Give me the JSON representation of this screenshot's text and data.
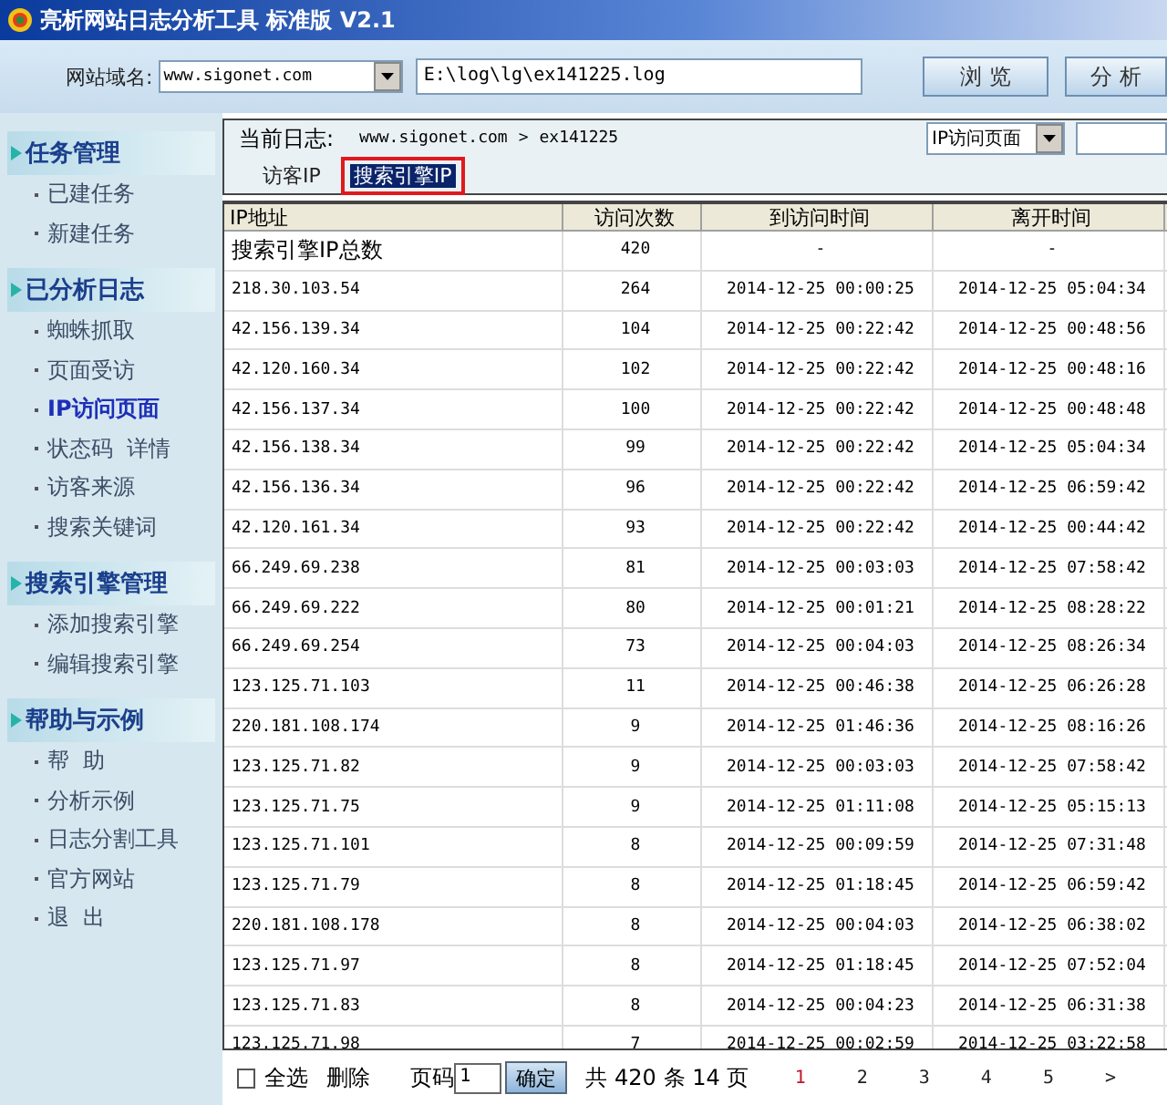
{
  "window": {
    "title": "亮析网站日志分析工具 标准版 V2.1"
  },
  "toolbar": {
    "domain_label": "网站域名:",
    "domain_value": "www.sigonet.com",
    "path_value": "E:\\log\\lg\\ex141225.log",
    "buttons": [
      "浏 览",
      "分 析"
    ]
  },
  "sidebar": {
    "groups": [
      {
        "title": "任务管理",
        "items": [
          {
            "label": "已建任务",
            "selected": false
          },
          {
            "label": "新建任务",
            "selected": false
          }
        ]
      },
      {
        "title": "已分析日志",
        "items": [
          {
            "label": "蜘蛛抓取",
            "selected": false
          },
          {
            "label": "页面受访",
            "selected": false
          },
          {
            "label": "IP访问页面",
            "selected": true
          },
          {
            "label": "状态码  详情",
            "selected": false
          },
          {
            "label": "访客来源",
            "selected": false
          },
          {
            "label": "搜索关键词",
            "selected": false
          }
        ]
      },
      {
        "title": "搜索引擎管理",
        "items": [
          {
            "label": "添加搜索引擎",
            "selected": false
          },
          {
            "label": "编辑搜索引擎",
            "selected": false
          }
        ]
      },
      {
        "title": "帮助与示例",
        "items": [
          {
            "label": "帮  助",
            "selected": false
          },
          {
            "label": "分析示例",
            "selected": false
          },
          {
            "label": "日志分割工具",
            "selected": false
          },
          {
            "label": "官方网站",
            "selected": false
          },
          {
            "label": "退  出",
            "selected": false
          }
        ]
      }
    ]
  },
  "breadcrumb": {
    "label": "当前日志:",
    "site": "www.sigonet.com",
    "separator": ">",
    "log": "ex141225"
  },
  "view_select": {
    "value": "IP访问页面"
  },
  "tabs": [
    {
      "label": "访客IP",
      "selected": false
    },
    {
      "label": "搜索引擎IP",
      "selected": true
    }
  ],
  "table": {
    "columns": [
      "IP地址",
      "访问次数",
      "到访问时间",
      "离开时间"
    ],
    "rows": [
      [
        "搜索引擎IP总数",
        "420",
        "-",
        "-"
      ],
      [
        "218.30.103.54",
        "264",
        "2014-12-25 00:00:25",
        "2014-12-25 05:04:34"
      ],
      [
        "42.156.139.34",
        "104",
        "2014-12-25 00:22:42",
        "2014-12-25 00:48:56"
      ],
      [
        "42.120.160.34",
        "102",
        "2014-12-25 00:22:42",
        "2014-12-25 00:48:16"
      ],
      [
        "42.156.137.34",
        "100",
        "2014-12-25 00:22:42",
        "2014-12-25 00:48:48"
      ],
      [
        "42.156.138.34",
        "99",
        "2014-12-25 00:22:42",
        "2014-12-25 05:04:34"
      ],
      [
        "42.156.136.34",
        "96",
        "2014-12-25 00:22:42",
        "2014-12-25 06:59:42"
      ],
      [
        "42.120.161.34",
        "93",
        "2014-12-25 00:22:42",
        "2014-12-25 00:44:42"
      ],
      [
        "66.249.69.238",
        "81",
        "2014-12-25 00:03:03",
        "2014-12-25 07:58:42"
      ],
      [
        "66.249.69.222",
        "80",
        "2014-12-25 00:01:21",
        "2014-12-25 08:28:22"
      ],
      [
        "66.249.69.254",
        "73",
        "2014-12-25 00:04:03",
        "2014-12-25 08:26:34"
      ],
      [
        "123.125.71.103",
        "11",
        "2014-12-25 00:46:38",
        "2014-12-25 06:26:28"
      ],
      [
        "220.181.108.174",
        "9",
        "2014-12-25 01:46:36",
        "2014-12-25 08:16:26"
      ],
      [
        "123.125.71.82",
        "9",
        "2014-12-25 00:03:03",
        "2014-12-25 07:58:42"
      ],
      [
        "123.125.71.75",
        "9",
        "2014-12-25 01:11:08",
        "2014-12-25 05:15:13"
      ],
      [
        "123.125.71.101",
        "8",
        "2014-12-25 00:09:59",
        "2014-12-25 07:31:48"
      ],
      [
        "123.125.71.79",
        "8",
        "2014-12-25 01:18:45",
        "2014-12-25 06:59:42"
      ],
      [
        "220.181.108.178",
        "8",
        "2014-12-25 00:04:03",
        "2014-12-25 06:38:02"
      ],
      [
        "123.125.71.97",
        "8",
        "2014-12-25 01:18:45",
        "2014-12-25 07:52:04"
      ],
      [
        "123.125.71.83",
        "8",
        "2014-12-25 00:04:23",
        "2014-12-25 06:31:38"
      ],
      [
        "123.125.71.98",
        "7",
        "2014-12-25 00:02:59",
        "2014-12-25 03:22:58"
      ]
    ]
  },
  "footer": {
    "select_all": {
      "label": "全选",
      "checked": false
    },
    "delete": "删除",
    "page_label": "页码",
    "page_value": "1",
    "confirm": "确定",
    "summary": "共 420 条 14 页",
    "pages": [
      {
        "label": "1",
        "selected": true
      },
      {
        "label": "2",
        "selected": false
      },
      {
        "label": "3",
        "selected": false
      },
      {
        "label": "4",
        "selected": false
      },
      {
        "label": "5",
        "selected": false
      }
    ],
    "next": ">"
  }
}
